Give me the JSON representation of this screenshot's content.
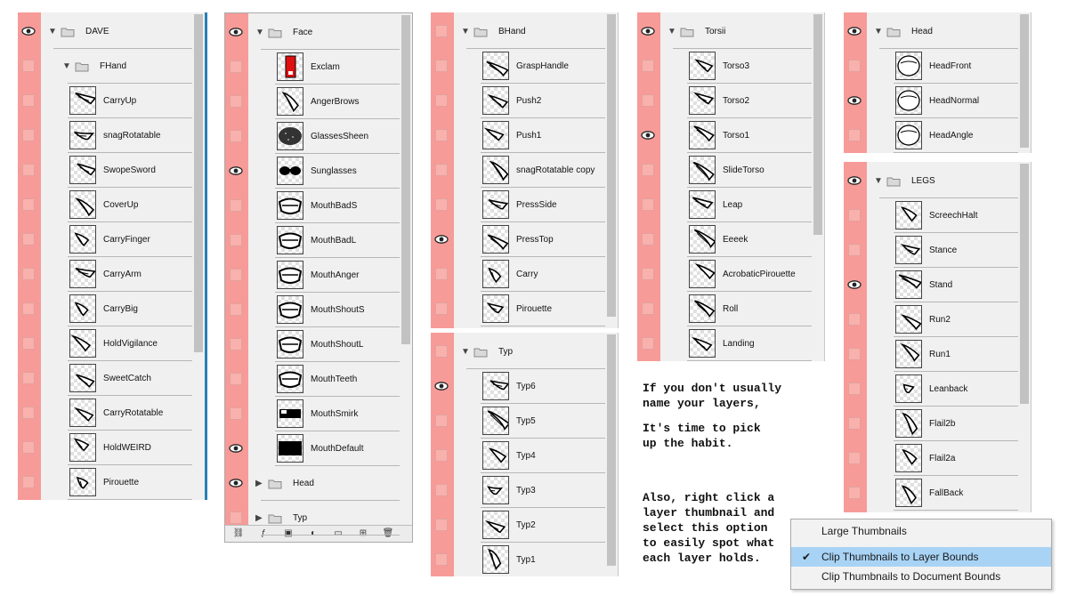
{
  "panels": [
    {
      "id": "p1",
      "rows": [
        {
          "type": "group",
          "label": "DAVE",
          "visible": true,
          "indent": 0,
          "open": true
        },
        {
          "type": "group",
          "label": "FHand",
          "visible": false,
          "indent": 1,
          "open": true
        },
        {
          "type": "layer",
          "label": "CarryUp",
          "visible": false
        },
        {
          "type": "layer",
          "label": "snagRotatable",
          "visible": false
        },
        {
          "type": "layer",
          "label": "SwopeSword",
          "visible": false
        },
        {
          "type": "layer",
          "label": "CoverUp",
          "visible": false
        },
        {
          "type": "layer",
          "label": "CarryFinger",
          "visible": false
        },
        {
          "type": "layer",
          "label": "CarryArm",
          "visible": false
        },
        {
          "type": "layer",
          "label": "CarryBig",
          "visible": false
        },
        {
          "type": "layer",
          "label": "HoldVigilance",
          "visible": false
        },
        {
          "type": "layer",
          "label": "SweetCatch",
          "visible": false
        },
        {
          "type": "layer",
          "label": "CarryRotatable",
          "visible": false
        },
        {
          "type": "layer",
          "label": "HoldWEIRD",
          "visible": false
        },
        {
          "type": "layer",
          "label": "Pirouette",
          "visible": false
        }
      ]
    },
    {
      "id": "p2",
      "rows": [
        {
          "type": "group",
          "label": "Face",
          "visible": true,
          "indent": 0,
          "open": true
        },
        {
          "type": "layer",
          "label": "Exclam",
          "visible": false,
          "thumb": "red"
        },
        {
          "type": "layer",
          "label": "AngerBrows",
          "visible": false
        },
        {
          "type": "layer",
          "label": "GlassesSheen",
          "visible": false,
          "thumb": "dark"
        },
        {
          "type": "layer",
          "label": "Sunglasses",
          "visible": true,
          "thumb": "glasses"
        },
        {
          "type": "layer",
          "label": "MouthBadS",
          "visible": false,
          "thumb": "mouth"
        },
        {
          "type": "layer",
          "label": "MouthBadL",
          "visible": false,
          "thumb": "mouth"
        },
        {
          "type": "layer",
          "label": "MouthAnger",
          "visible": false,
          "thumb": "mouth"
        },
        {
          "type": "layer",
          "label": "MouthShoutS",
          "visible": false,
          "thumb": "mouth"
        },
        {
          "type": "layer",
          "label": "MouthShoutL",
          "visible": false,
          "thumb": "mouth"
        },
        {
          "type": "layer",
          "label": "MouthTeeth",
          "visible": false,
          "thumb": "mouth"
        },
        {
          "type": "layer",
          "label": "MouthSmirk",
          "visible": false,
          "thumb": "mouthblack"
        },
        {
          "type": "layer",
          "label": "MouthDefault",
          "visible": true,
          "thumb": "black"
        },
        {
          "type": "group",
          "label": "Head",
          "visible": true,
          "indent": 0,
          "open": false
        },
        {
          "type": "group",
          "label": "Typ",
          "visible": false,
          "indent": 0,
          "open": false
        }
      ]
    },
    {
      "id": "p3",
      "rows": [
        {
          "type": "group",
          "label": "BHand",
          "visible": false,
          "indent": 0,
          "open": true
        },
        {
          "type": "layer",
          "label": "GraspHandle",
          "visible": false
        },
        {
          "type": "layer",
          "label": "Push2",
          "visible": false
        },
        {
          "type": "layer",
          "label": "Push1",
          "visible": false
        },
        {
          "type": "layer",
          "label": "snagRotatable copy",
          "visible": false
        },
        {
          "type": "layer",
          "label": "PressSide",
          "visible": false
        },
        {
          "type": "layer",
          "label": "PressTop",
          "visible": true
        },
        {
          "type": "layer",
          "label": "Carry",
          "visible": false
        },
        {
          "type": "layer",
          "label": "Pirouette",
          "visible": false
        }
      ]
    },
    {
      "id": "p3b",
      "rows": [
        {
          "type": "group",
          "label": "Typ",
          "visible": false,
          "indent": 0,
          "open": true
        },
        {
          "type": "layer",
          "label": "Typ6",
          "visible": true
        },
        {
          "type": "layer",
          "label": "Typ5",
          "visible": false
        },
        {
          "type": "layer",
          "label": "Typ4",
          "visible": false
        },
        {
          "type": "layer",
          "label": "Typ3",
          "visible": false
        },
        {
          "type": "layer",
          "label": "Typ2",
          "visible": false
        },
        {
          "type": "layer",
          "label": "Typ1",
          "visible": false
        }
      ]
    },
    {
      "id": "p4",
      "rows": [
        {
          "type": "group",
          "label": "Torsii",
          "visible": true,
          "indent": 0,
          "open": true
        },
        {
          "type": "layer",
          "label": "Torso3",
          "visible": false
        },
        {
          "type": "layer",
          "label": "Torso2",
          "visible": false
        },
        {
          "type": "layer",
          "label": "Torso1",
          "visible": true
        },
        {
          "type": "layer",
          "label": "SlideTorso",
          "visible": false
        },
        {
          "type": "layer",
          "label": "Leap",
          "visible": false
        },
        {
          "type": "layer",
          "label": "Eeeek",
          "visible": false
        },
        {
          "type": "layer",
          "label": "AcrobaticPirouette",
          "visible": false
        },
        {
          "type": "layer",
          "label": "Roll",
          "visible": false
        },
        {
          "type": "layer",
          "label": "Landing",
          "visible": false
        }
      ]
    },
    {
      "id": "p5",
      "rows": [
        {
          "type": "group",
          "label": "Head",
          "visible": true,
          "indent": 0,
          "open": true
        },
        {
          "type": "layer",
          "label": "HeadFront",
          "visible": false,
          "thumb": "head"
        },
        {
          "type": "layer",
          "label": "HeadNormal",
          "visible": true,
          "thumb": "head"
        },
        {
          "type": "layer",
          "label": "HeadAngle",
          "visible": false,
          "thumb": "head"
        }
      ]
    },
    {
      "id": "p6",
      "rows": [
        {
          "type": "group",
          "label": "LEGS",
          "visible": true,
          "indent": 0,
          "open": true
        },
        {
          "type": "layer",
          "label": "ScreechHalt",
          "visible": false
        },
        {
          "type": "layer",
          "label": "Stance",
          "visible": false
        },
        {
          "type": "layer",
          "label": "Stand",
          "visible": true
        },
        {
          "type": "layer",
          "label": "Run2",
          "visible": false
        },
        {
          "type": "layer",
          "label": "Run1",
          "visible": false
        },
        {
          "type": "layer",
          "label": "Leanback",
          "visible": false
        },
        {
          "type": "layer",
          "label": "Flail2b",
          "visible": false
        },
        {
          "type": "layer",
          "label": "Flail2a",
          "visible": false
        },
        {
          "type": "layer",
          "label": "FallBack",
          "visible": false
        }
      ]
    }
  ],
  "note": {
    "para1": "If you don't usually\nname your layers,",
    "para2": "It's time to pick\nup the habit.",
    "para3": "Also, right click a\nlayer thumbnail and\nselect this option\nto easily spot what\neach layer holds."
  },
  "context_menu": {
    "items": [
      {
        "label": "Large Thumbnails",
        "checked": false,
        "selected": false
      },
      {
        "label": "Clip Thumbnails to Layer Bounds",
        "checked": true,
        "selected": true
      },
      {
        "label": "Clip Thumbnails to Document Bounds",
        "checked": false,
        "selected": false
      }
    ]
  },
  "bottom_toolbar": {
    "icons": [
      "link-icon",
      "fx-icon",
      "mask-icon",
      "adjustment-icon",
      "folder-icon",
      "new-layer-icon",
      "trash-icon"
    ]
  },
  "colors": {
    "eye_column": "#f79b98",
    "panel_bg": "#f0f0f0",
    "menu_highlight": "#a8d3f5",
    "accent": "#2a7fb5"
  }
}
